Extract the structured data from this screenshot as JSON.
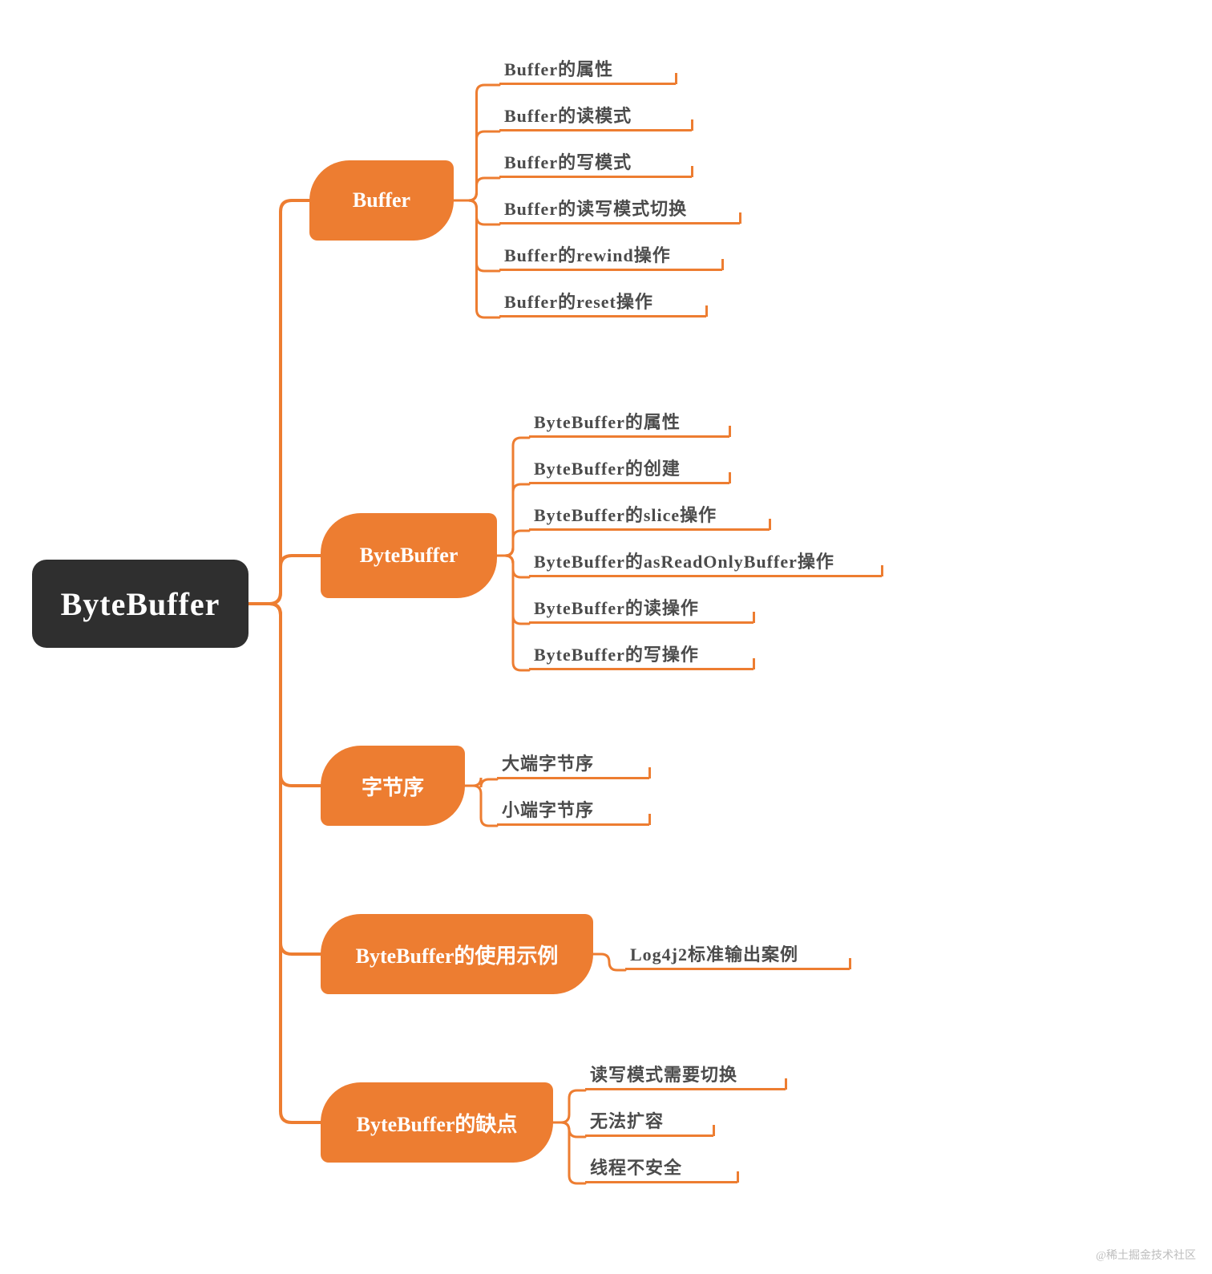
{
  "root": {
    "label": "ByteBuffer"
  },
  "branches": [
    {
      "label": "Buffer",
      "leaves": [
        "Buffer的属性",
        "Buffer的读模式",
        "Buffer的写模式",
        "Buffer的读写模式切换",
        "Buffer的rewind操作",
        "Buffer的reset操作"
      ]
    },
    {
      "label": "ByteBuffer",
      "leaves": [
        "ByteBuffer的属性",
        "ByteBuffer的创建",
        "ByteBuffer的slice操作",
        "ByteBuffer的asReadOnlyBuffer操作",
        "ByteBuffer的读操作",
        "ByteBuffer的写操作"
      ]
    },
    {
      "label": "字节序",
      "leaves": [
        "大端字节序",
        "小端字节序"
      ]
    },
    {
      "label": "ByteBuffer的使用示例",
      "leaves": [
        "Log4j2标准输出案例"
      ]
    },
    {
      "label": "ByteBuffer的缺点",
      "leaves": [
        "读写模式需要切换",
        "无法扩容",
        "线程不安全"
      ]
    }
  ],
  "watermark": "@稀土掘金技术社区",
  "colors": {
    "accent": "#ED7D31",
    "rootBg": "#2f2f2f",
    "rootFg": "#ffffff",
    "leafFg": "#4b4b4b"
  }
}
